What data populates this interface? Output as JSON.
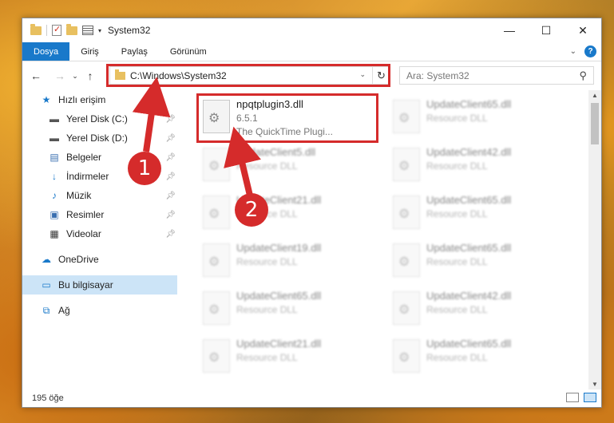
{
  "window": {
    "title": "System32",
    "controls": {
      "minimize": "—",
      "maximize": "☐",
      "close": "✕"
    }
  },
  "ribbon": {
    "tabs": [
      "Dosya",
      "Giriş",
      "Paylaş",
      "Görünüm"
    ]
  },
  "nav": {
    "back": "←",
    "forward": "→",
    "recent": "⌄",
    "up": "↑",
    "address_path": "C:\\Windows\\System32",
    "search_placeholder": "Ara: System32"
  },
  "sidebar": {
    "items": [
      {
        "label": "Hızlı erişim",
        "icon": "star-icon",
        "glyph": "★",
        "color": "#1979ca"
      },
      {
        "label": "Yerel Disk (C:)",
        "icon": "drive-icon",
        "glyph": "▬",
        "color": "#555555",
        "pinned": true
      },
      {
        "label": "Yerel Disk (D:)",
        "icon": "drive-icon",
        "glyph": "▬",
        "color": "#555555",
        "pinned": true
      },
      {
        "label": "Belgeler",
        "icon": "documents-icon",
        "glyph": "▤",
        "color": "#3a6fb0",
        "pinned": true
      },
      {
        "label": "İndirmeler",
        "icon": "download-icon",
        "glyph": "↓",
        "color": "#1979ca",
        "pinned": true
      },
      {
        "label": "Müzik",
        "icon": "music-icon",
        "glyph": "♪",
        "color": "#1979ca",
        "pinned": true
      },
      {
        "label": "Resimler",
        "icon": "pictures-icon",
        "glyph": "▣",
        "color": "#3a6fb0",
        "pinned": true
      },
      {
        "label": "Videolar",
        "icon": "videos-icon",
        "glyph": "▦",
        "color": "#333333",
        "pinned": true
      },
      {
        "label": "OneDrive",
        "icon": "cloud-icon",
        "glyph": "☁",
        "color": "#1979ca"
      },
      {
        "label": "Bu bilgisayar",
        "icon": "computer-icon",
        "glyph": "▭",
        "color": "#1979ca",
        "selected": true
      },
      {
        "label": "Ağ",
        "icon": "network-icon",
        "glyph": "⧉",
        "color": "#1979ca"
      }
    ]
  },
  "files": {
    "highlighted": {
      "name": "npqtplugin3.dll",
      "version": "6.5.1",
      "description": "The QuickTime Plugi..."
    },
    "left_column": [
      {
        "name": "UpdateClient5.dll",
        "type": "Resource DLL"
      },
      {
        "name": "UpdateClient21.dll",
        "type": "Resource DLL"
      },
      {
        "name": "UpdateClient19.dll",
        "type": "Resource DLL"
      },
      {
        "name": "UpdateClient65.dll",
        "type": "Resource DLL"
      },
      {
        "name": "UpdateClient21.dll",
        "type": "Resource DLL"
      }
    ],
    "right_column": [
      {
        "name": "UpdateClient65.dll",
        "type": "Resource DLL"
      },
      {
        "name": "UpdateClient42.dll",
        "type": "Resource DLL"
      },
      {
        "name": "UpdateClient65.dll",
        "type": "Resource DLL"
      },
      {
        "name": "UpdateClient65.dll",
        "type": "Resource DLL"
      },
      {
        "name": "UpdateClient42.dll",
        "type": "Resource DLL"
      },
      {
        "name": "UpdateClient65.dll",
        "type": "Resource DLL"
      }
    ]
  },
  "status": {
    "count": "195 öğe"
  },
  "callouts": [
    "1",
    "2"
  ],
  "colors": {
    "accent": "#1979ca",
    "annotation_red": "#d52b2b",
    "selected_bg": "#cce4f7"
  }
}
